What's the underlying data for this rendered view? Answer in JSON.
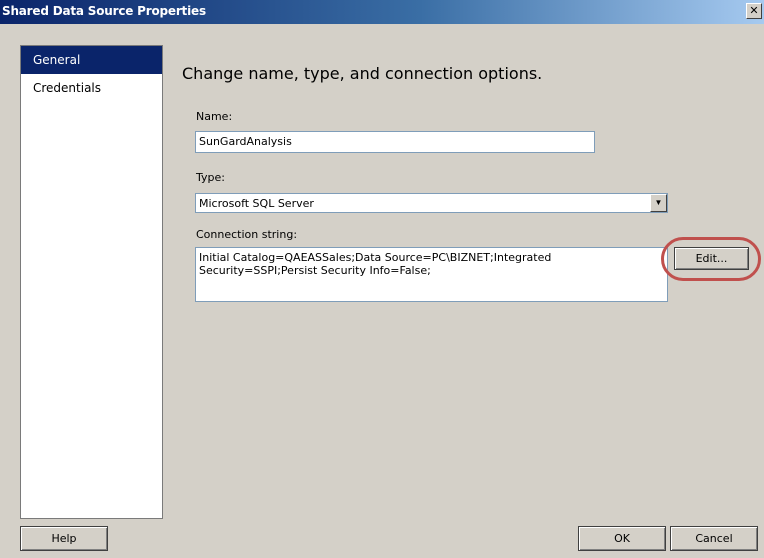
{
  "window": {
    "title": "Shared Data Source Properties",
    "close_glyph": "✕"
  },
  "nav": {
    "items": [
      {
        "label": "General",
        "selected": true
      },
      {
        "label": "Credentials",
        "selected": false
      }
    ]
  },
  "main": {
    "heading": "Change name, type, and connection options.",
    "name_label": "Name:",
    "name_value": "SunGardAnalysis",
    "type_label": "Type:",
    "type_value": "Microsoft SQL Server",
    "conn_label": "Connection string:",
    "conn_value": "Initial Catalog=QAEASSales;Data Source=PC\\BIZNET;Integrated\nSecurity=SSPI;Persist Security Info=False;",
    "edit_label": "Edit..."
  },
  "footer": {
    "help_label": "Help",
    "ok_label": "OK",
    "cancel_label": "Cancel"
  },
  "colors": {
    "titlebar": "#0a246a",
    "selection": "#0a246a",
    "highlight_circle": "#c0504d",
    "dialog_bg": "#d4d0c8"
  }
}
